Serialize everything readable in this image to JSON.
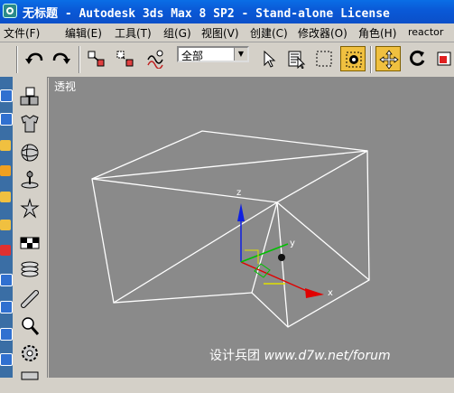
{
  "window": {
    "title": "无标题 - Autodesk 3ds Max 8 SP2 - Stand-alone License"
  },
  "menu": {
    "items": [
      "文件(F)",
      "编辑(E)",
      "工具(T)",
      "组(G)",
      "视图(V)",
      "创建(C)",
      "修改器(O)",
      "角色(H)",
      "reactor"
    ]
  },
  "toolbar": {
    "selection_filter": "全部",
    "icons": [
      "undo-icon",
      "redo-icon",
      "select-link-icon",
      "unlink-icon",
      "bind-spacewarp-icon",
      "select-object-icon",
      "select-by-name-icon",
      "rectangular-selection-icon",
      "window-crossing-icon",
      "select-move-icon",
      "select-rotate-icon",
      "select-scale-icon"
    ],
    "active_tool": "select-move-icon"
  },
  "viewport": {
    "label": "透视",
    "axis_labels": {
      "x": "x",
      "y": "y",
      "z": "z"
    },
    "colors": {
      "background": "#8a8a8a",
      "wireframe": "#ffffff",
      "x_axis": "#e00000",
      "y_axis": "#00c000",
      "z_axis": "#1020e0"
    }
  },
  "watermark": {
    "cn": "设计兵团",
    "url": "www.d7w.net/forum"
  },
  "left_toolbar": {
    "icons": [
      "rigidbody-collection-icon",
      "cloth-collection-icon",
      "softbody-collection-icon",
      "rope-collection-icon",
      "deforming-mesh-icon",
      "plane-icon",
      "spring-icon",
      "dashpot-icon",
      "motor-icon",
      "wind-icon",
      "toy-car-icon"
    ]
  }
}
